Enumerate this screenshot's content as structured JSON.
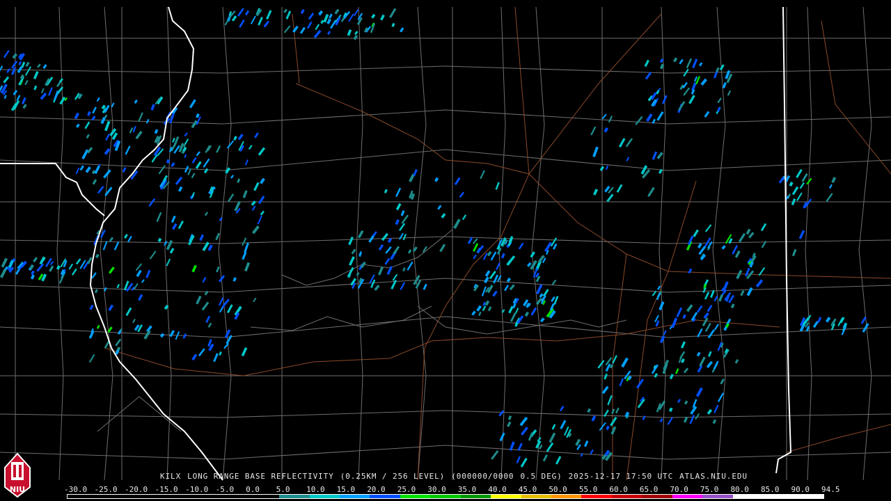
{
  "product": {
    "station": "KILX",
    "name": "LONG RANGE BASE REFLECTIVITY",
    "resolution": "(0.25KM / 256 LEVEL)",
    "volume": "(000000/0000",
    "tilt": "0.5 DEG)",
    "datetime": "2025-12-17 17:50 UTC",
    "source": "ATLAS.NIU.EDU"
  },
  "logo": {
    "text": "NIU",
    "color": "#c8102e"
  },
  "colors": {
    "background": "#000000",
    "county_lines": "#6e6e6e",
    "state_lines": "#ffffff",
    "highways": "#8b4a2b"
  },
  "scale": {
    "labels": [
      "-30.0",
      "-25.0",
      "-20.0",
      "-15.0",
      "-10.0",
      "-5.0",
      "0.0",
      "5.0",
      "10.0",
      "15.0",
      "20.0",
      "25.0",
      "30.0",
      "35.0",
      "40.0",
      "45.0",
      "50.0",
      "55.0",
      "60.0",
      "65.0",
      "70.0",
      "75.0",
      "80.0",
      "85.0",
      "90.0",
      "94.5"
    ],
    "colors": [
      "#000000",
      "#000000",
      "#000000",
      "#000000",
      "#000000",
      "#000000",
      "#000000",
      "#1e8c8c",
      "#00c8c8",
      "#00a0ff",
      "#0050ff",
      "#00e100",
      "#00c800",
      "#009600",
      "#ffff00",
      "#e6be00",
      "#ff9600",
      "#ff0000",
      "#c80000",
      "#a00000",
      "#ff00ff",
      "#9650c8",
      "#ffffff",
      "#ffffff",
      "#ffffff"
    ]
  }
}
